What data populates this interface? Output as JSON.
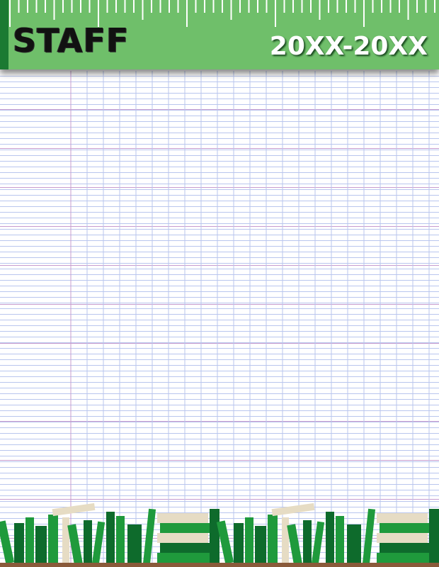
{
  "header": {
    "title": "STAFF",
    "year_range": "20XX-20XX"
  },
  "colors": {
    "ruler_green": "#6fbf6a",
    "ruler_dark_green": "#1b7a32",
    "grid_line": "#b9c6ee",
    "grid_major_line": "#c79ccf",
    "book_green_dark": "#0e6b2c",
    "book_green_mid": "#1f9a3c",
    "book_cream": "#e6dcc4",
    "shelf_wood": "#8a5a3a"
  },
  "decorations": {
    "header_ruler": "ruler-icon",
    "footer_books": "book-stack-icon"
  }
}
